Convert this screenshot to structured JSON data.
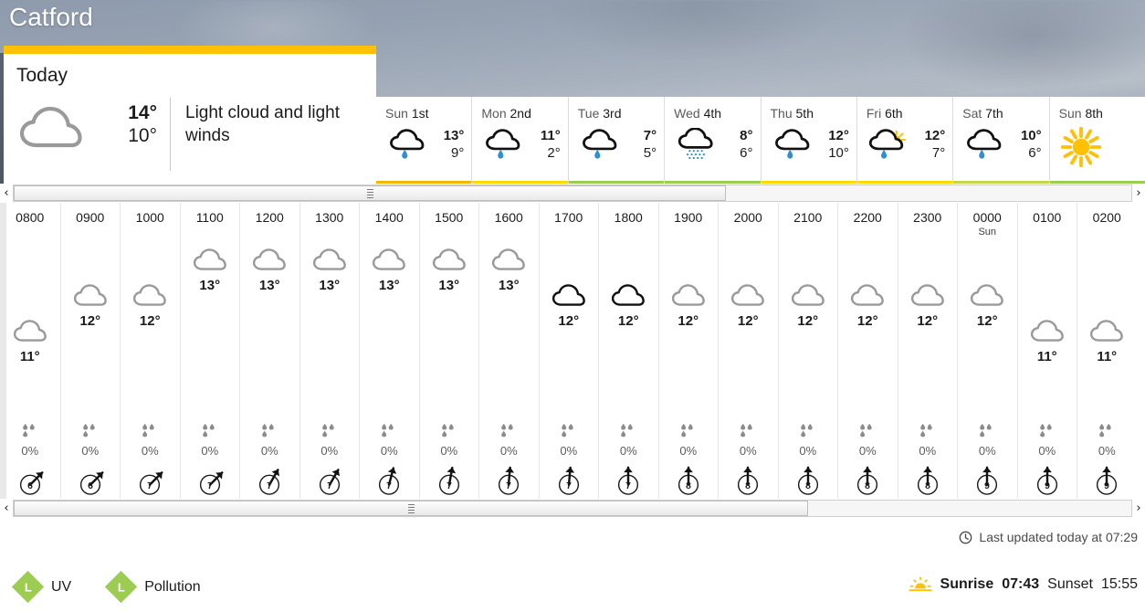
{
  "location": {
    "title": "Catford"
  },
  "today": {
    "label": "Today",
    "icon": "cloud-icon",
    "high": "14°",
    "low": "10°",
    "description": "Light cloud and light winds",
    "accent_color": "#ffc107"
  },
  "days": [
    {
      "weekday": "Sun",
      "date": "1st",
      "icon": "cloud-rain-icon",
      "high": "13°",
      "low": "9°",
      "bar_color": "#f5b800"
    },
    {
      "weekday": "Mon",
      "date": "2nd",
      "icon": "cloud-rain-icon",
      "high": "11°",
      "low": "2°",
      "bar_color": "#ffd900"
    },
    {
      "weekday": "Tue",
      "date": "3rd",
      "icon": "cloud-rain-icon",
      "high": "7°",
      "low": "5°",
      "bar_color": "#9ccc52"
    },
    {
      "weekday": "Wed",
      "date": "4th",
      "icon": "cloud-drizzle-icon",
      "high": "8°",
      "low": "6°",
      "bar_color": "#9ccc52"
    },
    {
      "weekday": "Thu",
      "date": "5th",
      "icon": "cloud-rain-icon",
      "high": "12°",
      "low": "10°",
      "bar_color": "#ffd900"
    },
    {
      "weekday": "Fri",
      "date": "6th",
      "icon": "sun-cloud-rain-icon",
      "high": "12°",
      "low": "7°",
      "bar_color": "#ffd900"
    },
    {
      "weekday": "Sat",
      "date": "7th",
      "icon": "cloud-rain-icon",
      "high": "10°",
      "low": "6°",
      "bar_color": "#c4d64a"
    },
    {
      "weekday": "Sun",
      "date": "8th",
      "icon": "sun-icon",
      "high": "",
      "low": "",
      "bar_color": "#9ccc52"
    }
  ],
  "hourly": {
    "columns": [
      {
        "time": "0800",
        "sub": "",
        "icon": "cloud-icon",
        "icon_tone": "grey",
        "temp": "11°",
        "level": 11,
        "precip": "0%",
        "precip_icon": "raindrops-icon",
        "wind_speed": "6",
        "wind_dir": 45
      },
      {
        "time": "0900",
        "sub": "",
        "icon": "cloud-icon",
        "icon_tone": "grey",
        "temp": "12°",
        "level": 12,
        "precip": "0%",
        "precip_icon": "raindrops-icon",
        "wind_speed": "6",
        "wind_dir": 45
      },
      {
        "time": "1000",
        "sub": "",
        "icon": "cloud-icon",
        "icon_tone": "grey",
        "temp": "12°",
        "level": 12,
        "precip": "0%",
        "precip_icon": "raindrops-icon",
        "wind_speed": "7",
        "wind_dir": 45
      },
      {
        "time": "1100",
        "sub": "",
        "icon": "cloud-icon",
        "icon_tone": "grey",
        "temp": "13°",
        "level": 13,
        "precip": "0%",
        "precip_icon": "raindrops-icon",
        "wind_speed": "7",
        "wind_dir": 45
      },
      {
        "time": "1200",
        "sub": "",
        "icon": "cloud-icon",
        "icon_tone": "grey",
        "temp": "13°",
        "level": 13,
        "precip": "0%",
        "precip_icon": "raindrops-icon",
        "wind_speed": "7",
        "wind_dir": 30
      },
      {
        "time": "1300",
        "sub": "",
        "icon": "cloud-icon",
        "icon_tone": "grey",
        "temp": "13°",
        "level": 13,
        "precip": "0%",
        "precip_icon": "raindrops-icon",
        "wind_speed": "7",
        "wind_dir": 30
      },
      {
        "time": "1400",
        "sub": "",
        "icon": "cloud-icon",
        "icon_tone": "grey",
        "temp": "13°",
        "level": 13,
        "precip": "0%",
        "precip_icon": "raindrops-icon",
        "wind_speed": "7",
        "wind_dir": 15
      },
      {
        "time": "1500",
        "sub": "",
        "icon": "cloud-icon",
        "icon_tone": "grey",
        "temp": "13°",
        "level": 13,
        "precip": "0%",
        "precip_icon": "raindrops-icon",
        "wind_speed": "7",
        "wind_dir": 10
      },
      {
        "time": "1600",
        "sub": "",
        "icon": "cloud-icon",
        "icon_tone": "grey",
        "temp": "13°",
        "level": 13,
        "precip": "0%",
        "precip_icon": "raindrops-icon",
        "wind_speed": "7",
        "wind_dir": 5
      },
      {
        "time": "1700",
        "sub": "",
        "icon": "cloud-icon",
        "icon_tone": "dark",
        "temp": "12°",
        "level": 12,
        "precip": "0%",
        "precip_icon": "raindrops-icon",
        "wind_speed": "7",
        "wind_dir": 5
      },
      {
        "time": "1800",
        "sub": "",
        "icon": "cloud-icon",
        "icon_tone": "dark",
        "temp": "12°",
        "level": 12,
        "precip": "0%",
        "precip_icon": "raindrops-icon",
        "wind_speed": "7",
        "wind_dir": 0
      },
      {
        "time": "1900",
        "sub": "",
        "icon": "cloud-icon",
        "icon_tone": "grey",
        "temp": "12°",
        "level": 12,
        "precip": "0%",
        "precip_icon": "raindrops-icon",
        "wind_speed": "8",
        "wind_dir": 0
      },
      {
        "time": "2000",
        "sub": "",
        "icon": "cloud-icon",
        "icon_tone": "grey",
        "temp": "12°",
        "level": 12,
        "precip": "0%",
        "precip_icon": "raindrops-icon",
        "wind_speed": "8",
        "wind_dir": 0
      },
      {
        "time": "2100",
        "sub": "",
        "icon": "cloud-icon",
        "icon_tone": "grey",
        "temp": "12°",
        "level": 12,
        "precip": "0%",
        "precip_icon": "raindrops-icon",
        "wind_speed": "8",
        "wind_dir": 0
      },
      {
        "time": "2200",
        "sub": "",
        "icon": "cloud-icon",
        "icon_tone": "grey",
        "temp": "12°",
        "level": 12,
        "precip": "0%",
        "precip_icon": "raindrops-icon",
        "wind_speed": "8",
        "wind_dir": 0
      },
      {
        "time": "2300",
        "sub": "",
        "icon": "cloud-icon",
        "icon_tone": "grey",
        "temp": "12°",
        "level": 12,
        "precip": "0%",
        "precip_icon": "raindrops-icon",
        "wind_speed": "8",
        "wind_dir": 0
      },
      {
        "time": "0000",
        "sub": "Sun",
        "icon": "cloud-icon",
        "icon_tone": "grey",
        "temp": "12°",
        "level": 12,
        "precip": "0%",
        "precip_icon": "raindrops-icon",
        "wind_speed": "9",
        "wind_dir": 0
      },
      {
        "time": "0100",
        "sub": "",
        "icon": "cloud-icon",
        "icon_tone": "grey",
        "temp": "11°",
        "level": 11,
        "precip": "0%",
        "precip_icon": "raindrops-icon",
        "wind_speed": "9",
        "wind_dir": 0
      },
      {
        "time": "0200",
        "sub": "",
        "icon": "cloud-icon",
        "icon_tone": "grey",
        "temp": "11°",
        "level": 11,
        "precip": "0%",
        "precip_icon": "raindrops-icon",
        "wind_speed": "9",
        "wind_dir": 0
      }
    ]
  },
  "scrollbars": {
    "left_arrow": "‹",
    "right_arrow": "›"
  },
  "footer": {
    "updated_text": "Last updated today at 07:29",
    "updated_icon": "clock-icon",
    "badges": [
      {
        "label": "UV",
        "value": "L",
        "color": "#9ccc52",
        "icon": "uv-diamond-icon"
      },
      {
        "label": "Pollution",
        "value": "L",
        "color": "#9ccc52",
        "icon": "pollution-diamond-icon"
      }
    ],
    "sun_icon": "sunrise-icon",
    "sunrise_label": "Sunrise",
    "sunrise_time": "07:43",
    "sunset_label": "Sunset",
    "sunset_time": "15:55"
  }
}
